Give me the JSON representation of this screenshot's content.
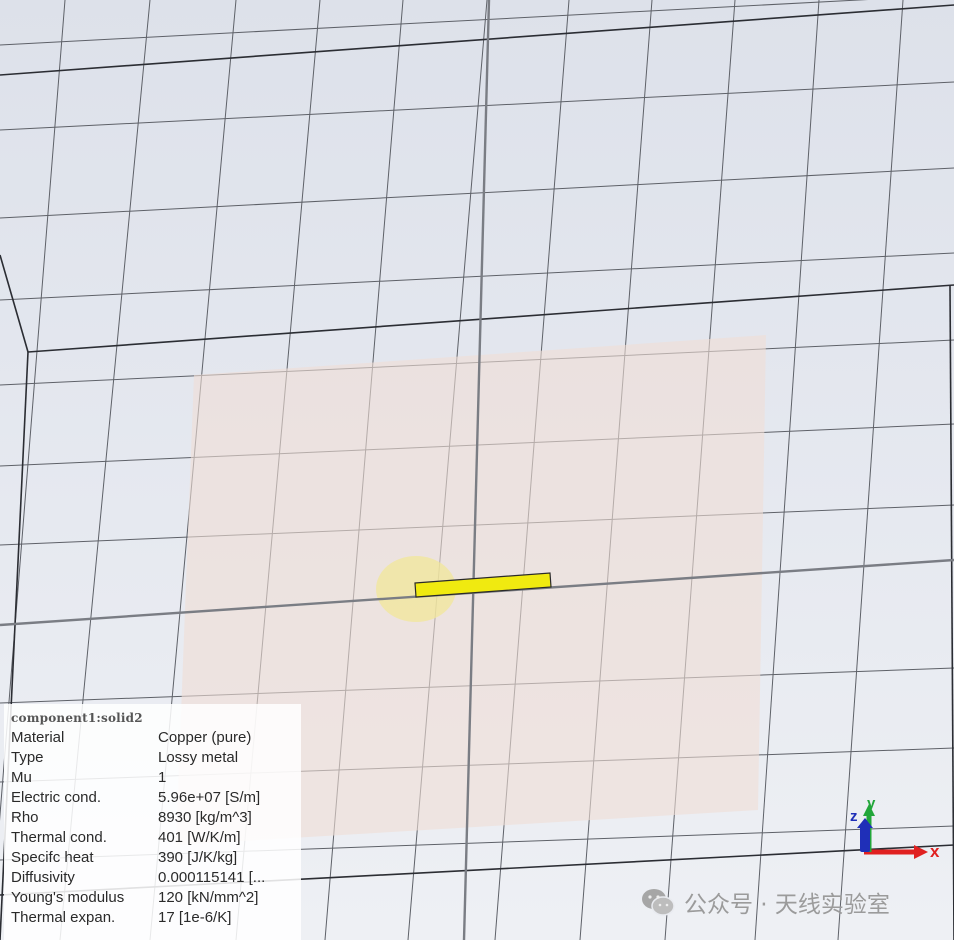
{
  "viewport": {
    "background_top": "#dde1ea",
    "grid_color": "#5e6168",
    "bounding_box_color": "#2b2d33",
    "substrate_color": "#f0ddd6",
    "highlight_color": "#f2e79a",
    "solid_color": "#f0ea10"
  },
  "info_panel": {
    "title": "component1:solid2",
    "rows": [
      {
        "key": "Material",
        "value": "Copper (pure)"
      },
      {
        "key": "Type",
        "value": "Lossy metal"
      },
      {
        "key": "Mu",
        "value": "1"
      },
      {
        "key": "Electric cond.",
        "value": "5.96e+07 [S/m]"
      },
      {
        "key": "Rho",
        "value": "8930 [kg/m^3]"
      },
      {
        "key": "Thermal cond.",
        "value": "401 [W/K/m]"
      },
      {
        "key": "Specifc heat",
        "value": "390 [J/K/kg]"
      },
      {
        "key": "Diffusivity",
        "value": "0.000115141 [..."
      },
      {
        "key": "Young's modulus",
        "value": "120 [kN/mm^2]"
      },
      {
        "key": "Thermal expan.",
        "value": "17 [1e-6/K]"
      }
    ]
  },
  "axes": {
    "x_label": "x",
    "y_label": "y",
    "z_label": "z",
    "x_color": "#e02020",
    "y_color": "#22a63a",
    "z_color": "#1f2fb8"
  },
  "watermark": {
    "icon": "wechat-icon",
    "text": "公众号 · 天线实验室"
  }
}
